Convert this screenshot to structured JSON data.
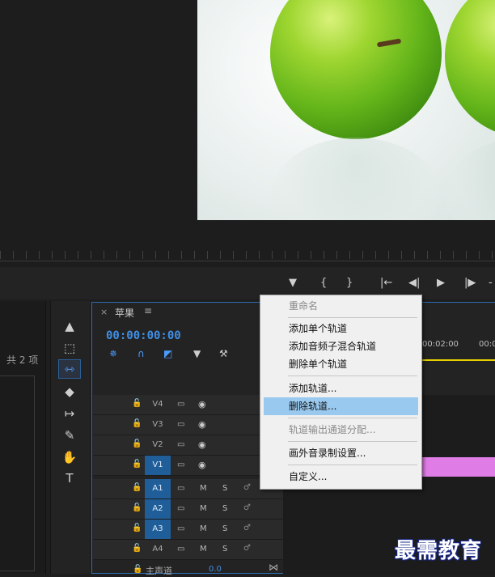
{
  "left_panel": {
    "item_count": "共 2 项"
  },
  "timeline": {
    "close_glyph": "×",
    "sequence_name": "苹果",
    "menu_glyph": "≡",
    "timecode": "00:00:00:00",
    "ruler_labels": [
      "00:02:00",
      "00:0"
    ],
    "tracks": [
      {
        "name": "V4",
        "type": "video",
        "targeted": false
      },
      {
        "name": "V3",
        "type": "video",
        "targeted": false
      },
      {
        "name": "V2",
        "type": "video",
        "targeted": false
      },
      {
        "name": "V1",
        "type": "video",
        "targeted": true
      },
      {
        "name": "A1",
        "type": "audio",
        "targeted": true
      },
      {
        "name": "A2",
        "type": "audio",
        "targeted": true
      },
      {
        "name": "A3",
        "type": "audio",
        "targeted": true
      },
      {
        "name": "A4",
        "type": "audio",
        "targeted": false
      }
    ],
    "mute_label": "M",
    "solo_label": "S",
    "master_track_label": "主声道",
    "master_volume": "0.0",
    "clip_color": "#e07ce6"
  },
  "context_menu": {
    "items": [
      {
        "label": "重命名",
        "enabled": false,
        "highlighted": false
      },
      {
        "label": "添加单个轨道",
        "enabled": true,
        "highlighted": false
      },
      {
        "label": "添加音频子混合轨道",
        "enabled": true,
        "highlighted": false
      },
      {
        "label": "删除单个轨道",
        "enabled": true,
        "highlighted": false
      },
      {
        "label": "添加轨道...",
        "enabled": true,
        "highlighted": false
      },
      {
        "label": "删除轨道...",
        "enabled": true,
        "highlighted": true
      },
      {
        "label": "轨道输出通道分配...",
        "enabled": false,
        "highlighted": false
      },
      {
        "label": "画外音录制设置...",
        "enabled": true,
        "highlighted": false
      },
      {
        "label": "自定义...",
        "enabled": true,
        "highlighted": false
      }
    ]
  },
  "watermark": {
    "text": "最需教育"
  },
  "colors": {
    "accent_blue": "#3f8fe6",
    "menu_highlight": "#99c9ef",
    "playhead": "#e5d100"
  }
}
